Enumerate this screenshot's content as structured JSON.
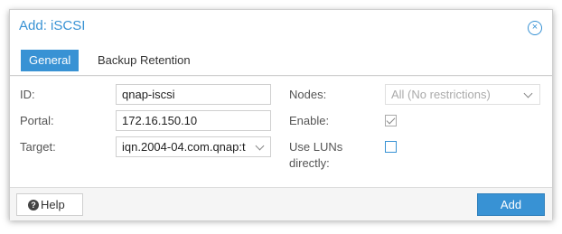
{
  "dialog": {
    "title": "Add: iSCSI",
    "close_icon": "×"
  },
  "tabs": [
    {
      "label": "General",
      "active": true
    },
    {
      "label": "Backup Retention",
      "active": false
    }
  ],
  "form": {
    "id_label": "ID:",
    "id_value": "qnap-iscsi",
    "portal_label": "Portal:",
    "portal_value": "172.16.150.10",
    "target_label": "Target:",
    "target_value": "iqn.2004-04.com.qnap:t",
    "nodes_label": "Nodes:",
    "nodes_value": "All (No restrictions)",
    "enable_label": "Enable:",
    "enable_checked": true,
    "use_luns_label_line1": "Use LUNs",
    "use_luns_label_line2": "directly:",
    "use_luns_checked": false
  },
  "footer": {
    "help_label": "Help",
    "help_icon": "?",
    "add_label": "Add"
  },
  "colors": {
    "accent": "#3892d4"
  }
}
